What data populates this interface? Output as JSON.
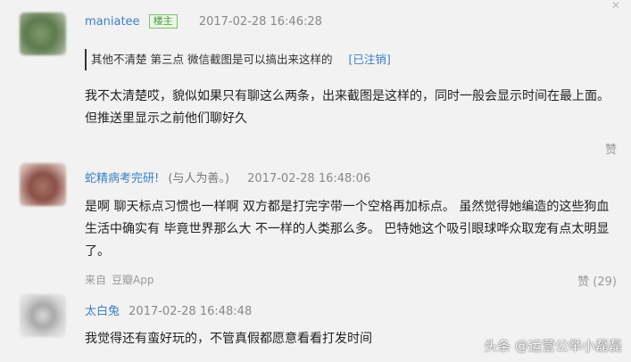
{
  "comments": [
    {
      "username": "maniatee",
      "badge": "楼主",
      "time": "2017-02-28 16:46:28",
      "quote": {
        "text": "其他不清楚 第三点 微信截图是可以搞出来这样的",
        "cancel_label": "[已注销]"
      },
      "body": "我不太清楚哎，貌似如果只有聊这么两条，出来截图是这样的，同时一般会显示时间在最上面。但推送里显示之前他们聊好久",
      "like_label": "赞"
    },
    {
      "username": "蛇精病考完研!",
      "username_suffix": "(与人为善。)",
      "time": "2017-02-28 16:48:06",
      "body": "是啊 聊天标点习惯也一样啊 双方都是打完字带一个空格再加标点。 虽然觉得她编造的这些狗血生活中确实有 毕竟世界那么大 不一样的人类那么多。 巴特她这个吸引眼球哗众取宠有点太明显了。",
      "source_prefix": "来自",
      "source_app": "豆瓣App",
      "like_label": "赞 (29)"
    },
    {
      "username": "太白兔",
      "time": "2017-02-28 16:48:48",
      "body": "我觉得还有蛮好玩的，不管真假都愿意看看打发时间"
    }
  ],
  "watermark": "头条 @运营公举小磊磊"
}
